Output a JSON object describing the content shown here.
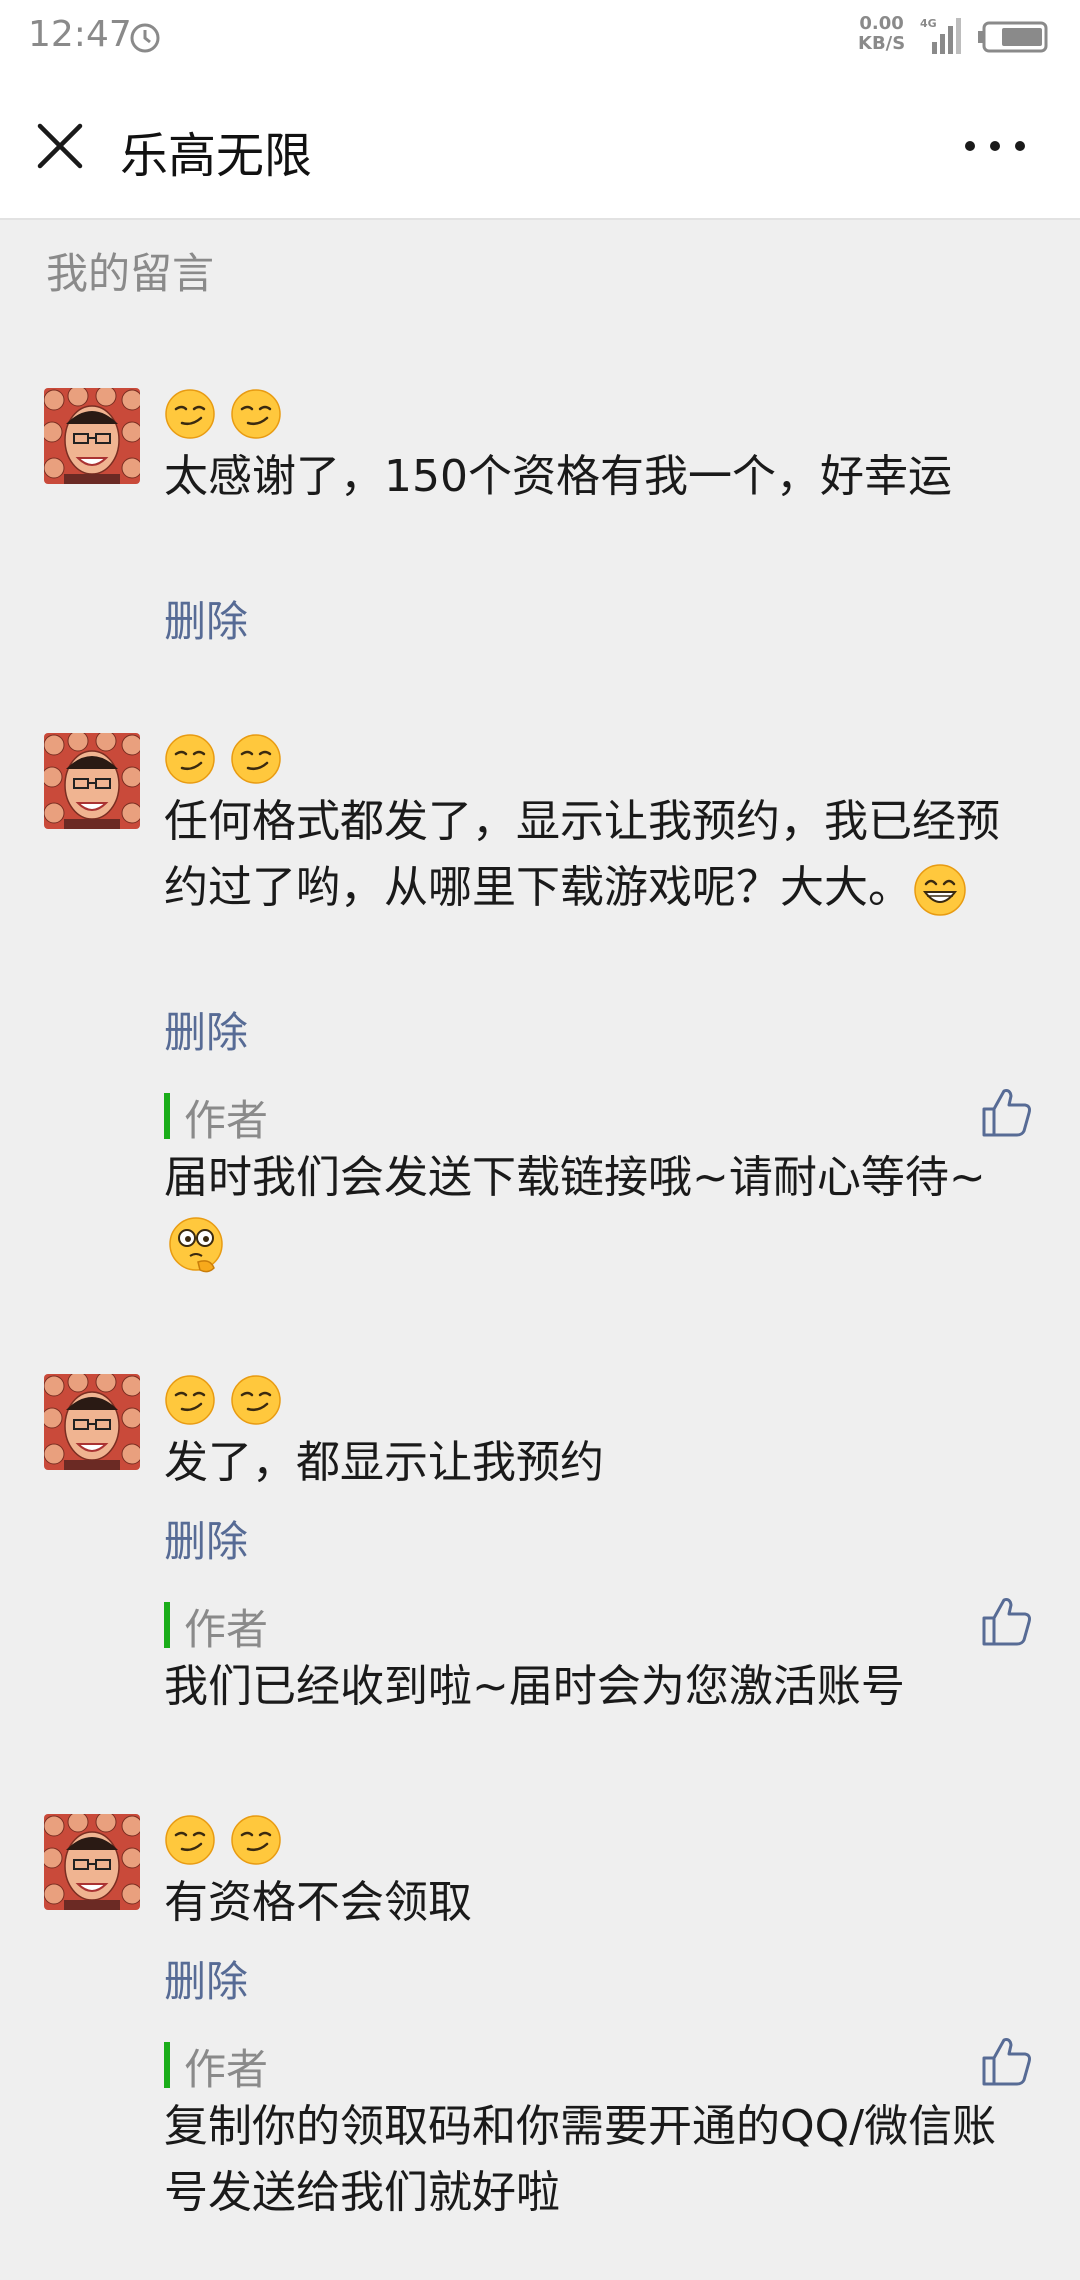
{
  "status_bar": {
    "time": "12:47",
    "net_speed_value": "0.00",
    "net_speed_unit": "KB/S",
    "network": "4G"
  },
  "header": {
    "title": "乐高无限",
    "close_icon": "close-icon",
    "more_icon": "more-icon"
  },
  "section_title": "我的留言",
  "comments": [
    {
      "emojis": "smirk smirk",
      "text": "太感谢了，150个资格有我一个，好幸运",
      "delete_label": "删除"
    },
    {
      "emojis": "smirk smirk",
      "text": "任何格式都发了，显示让我预约，我已经预约过了哟，从哪里下载游戏呢？大大。",
      "trailing_emoji": "grin",
      "delete_label": "删除",
      "reply": {
        "author_label": "作者",
        "text": "届时我们会发送下载链接哦~请耐心等待~",
        "trailing_emoji": "thinking-face"
      }
    },
    {
      "emojis": "smirk smirk",
      "text": "发了，都显示让我预约",
      "delete_label": "删除",
      "reply": {
        "author_label": "作者",
        "text": "我们已经收到啦~届时会为您激活账号"
      }
    },
    {
      "emojis": "smirk smirk",
      "text": "有资格不会领取",
      "delete_label": "删除",
      "reply": {
        "author_label": "作者",
        "text": "复制你的领取码和你需要开通的QQ/微信账号发送给我们就好啦"
      }
    }
  ],
  "colors": {
    "link": "#576b95",
    "author_bar": "#1aad19",
    "background": "#efefef"
  }
}
